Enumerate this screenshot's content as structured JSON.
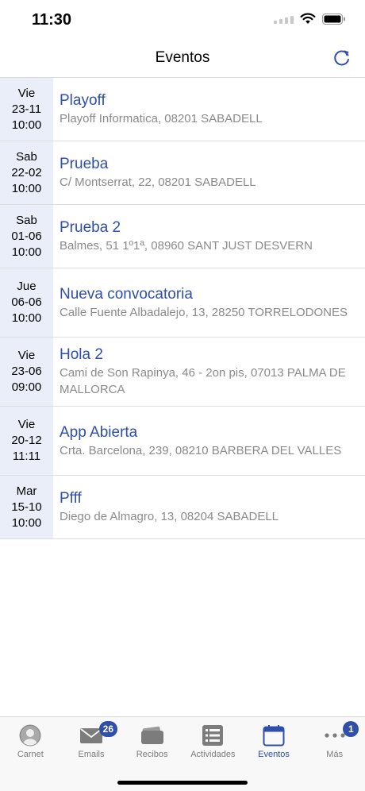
{
  "status_bar": {
    "time": "11:30"
  },
  "nav": {
    "title": "Eventos"
  },
  "events": [
    {
      "day": "Vie",
      "date": "23-11",
      "time": "10:00",
      "title": "Playoff",
      "address": "Playoff Informatica, 08201 SABADELL"
    },
    {
      "day": "Sab",
      "date": "22-02",
      "time": "10:00",
      "title": "Prueba",
      "address": "C/ Montserrat, 22, 08201 SABADELL"
    },
    {
      "day": "Sab",
      "date": "01-06",
      "time": "10:00",
      "title": "Prueba 2",
      "address": "Balmes, 51 1º1ª, 08960 SANT JUST DESVERN"
    },
    {
      "day": "Jue",
      "date": "06-06",
      "time": "10:00",
      "title": "Nueva convocatoria",
      "address": "Calle Fuente Albadalejo, 13, 28250 TORRELODONES"
    },
    {
      "day": "Vie",
      "date": "23-06",
      "time": "09:00",
      "title": "Hola 2",
      "address": "Cami de Son Rapinya, 46 - 2on pis, 07013 PALMA DE MALLORCA"
    },
    {
      "day": "Vie",
      "date": "20-12",
      "time": "11:11",
      "title": "App Abierta",
      "address": "Crta. Barcelona, 239, 08210 BARBERA DEL VALLES"
    },
    {
      "day": "Mar",
      "date": "15-10",
      "time": "10:00",
      "title": "Pfff",
      "address": "Diego de Almagro, 13, 08204 SABADELL"
    }
  ],
  "tabs": [
    {
      "id": "carnet",
      "label": "Carnet",
      "icon": "person-icon"
    },
    {
      "id": "emails",
      "label": "Emails",
      "icon": "envelope-icon",
      "badge": "26"
    },
    {
      "id": "recibos",
      "label": "Recibos",
      "icon": "wallet-icon"
    },
    {
      "id": "actividades",
      "label": "Actividades",
      "icon": "list-icon"
    },
    {
      "id": "eventos",
      "label": "Eventos",
      "icon": "calendar-icon",
      "active": true
    },
    {
      "id": "mas",
      "label": "Más",
      "icon": "more-icon",
      "badge": "1"
    }
  ],
  "colors": {
    "accent": "#2f4fa8",
    "date_bg": "#eaeef8",
    "address": "#8a8a8a",
    "inactive_tab": "#7c7c7c"
  }
}
